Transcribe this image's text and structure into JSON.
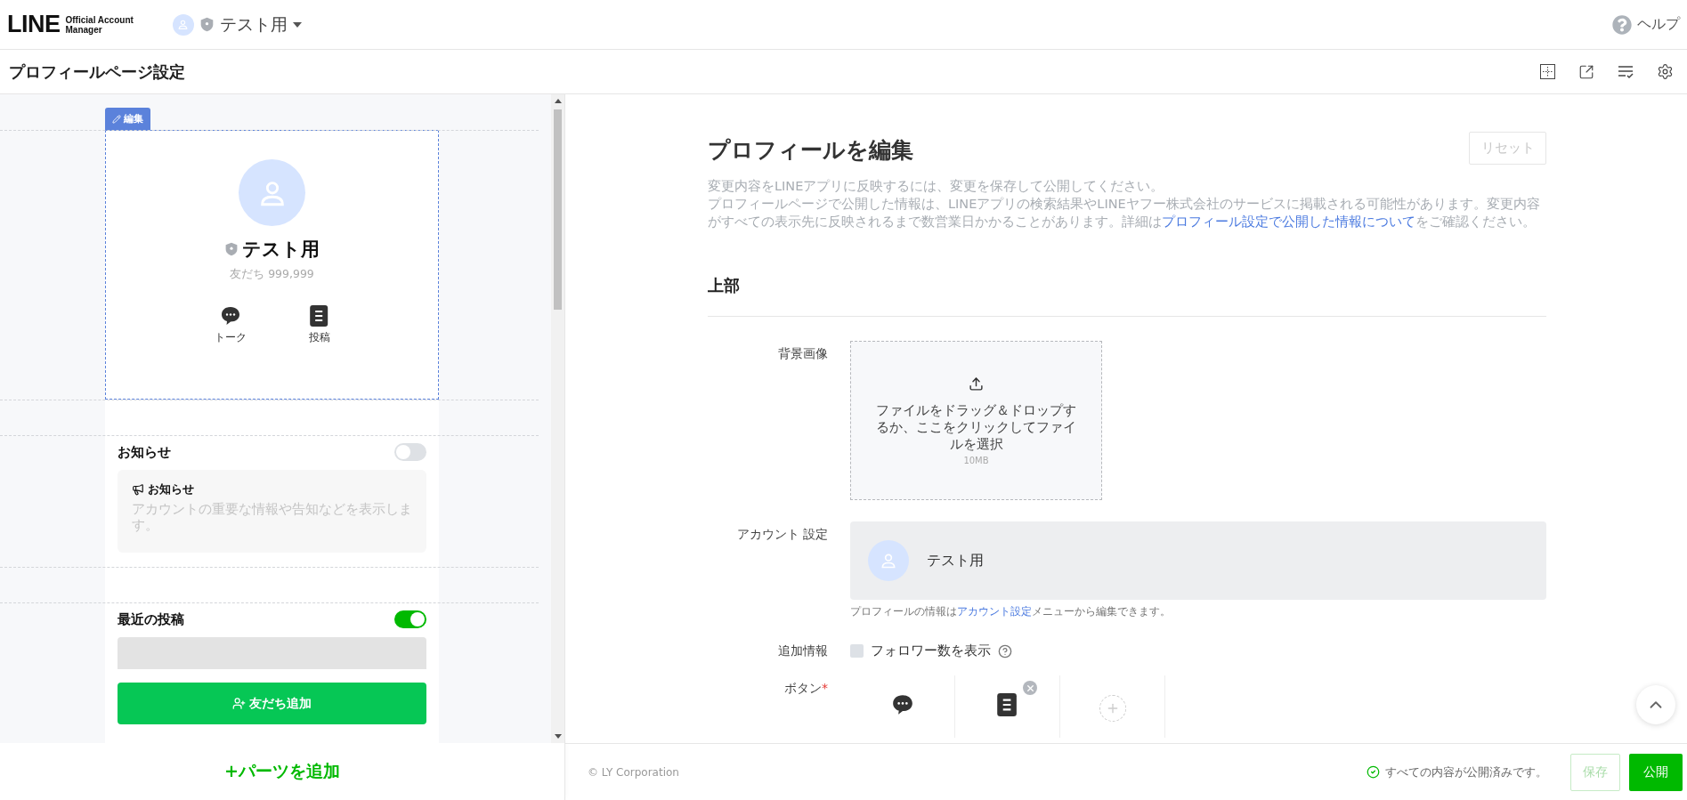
{
  "header": {
    "logo_wordmark": "LINE",
    "logo_line_1": "Official Account",
    "logo_line_2": "Manager",
    "account_name": "テスト用",
    "help": "ヘルプ"
  },
  "page_title": "プロフィールページ設定",
  "preview": {
    "edit_tag": "編集",
    "name": "テスト用",
    "friends": "友だち 999,999",
    "actions": [
      {
        "kind": "talk",
        "label": "トーク"
      },
      {
        "kind": "post",
        "label": "投稿"
      }
    ],
    "sections": [
      {
        "kind": "notice",
        "title": "お知らせ",
        "on": false,
        "card_title": "お知らせ",
        "card_text": "アカウントの重要な情報や告知などを表示します。"
      },
      {
        "kind": "posts",
        "title": "最近の投稿",
        "on": true
      }
    ],
    "add_friend": "友だち追加",
    "add_parts": "+パーツを追加"
  },
  "editor": {
    "title": "プロフィールを編集",
    "reset": "リセット",
    "intro": "変更内容をLINEアプリに反映するには、変更を保存して公開してください。",
    "notice_before": "プロフィールページで公開した情報は、LINEアプリの検索結果やLINEヤフー株式会社のサービスに掲載される可能性があります。変更内容がすべての表示先に反映されるまで数営業日かかることがあります。詳細は",
    "notice_link": "プロフィール設定で公開した情報について",
    "notice_after": "をご確認ください。",
    "section": "上部",
    "background": {
      "label": "背景画像",
      "upload_text": "ファイルをドラッグ＆ドロップするか、ここをクリックしてファイルを選択",
      "size": "10MB"
    },
    "account": {
      "label": "アカウント 設定",
      "name": "テスト用",
      "hint_before": "プロフィールの情報は",
      "hint_link": "アカウント設定",
      "hint_after": "メニューから編集できます。"
    },
    "extra": {
      "label": "追加情報",
      "checkbox": "フォロワー数を表示",
      "checked": false
    },
    "buttons": {
      "label": "ボタン",
      "required_mark": "*",
      "items": [
        {
          "kind": "talk",
          "removable": false
        },
        {
          "kind": "post",
          "removable": true
        },
        {
          "kind": "add",
          "removable": false
        }
      ]
    }
  },
  "footer": {
    "copyright": "© LY Corporation",
    "status": "すべての内容が公開済みです。",
    "save": "保存",
    "save_disabled": true,
    "publish": "公開"
  }
}
